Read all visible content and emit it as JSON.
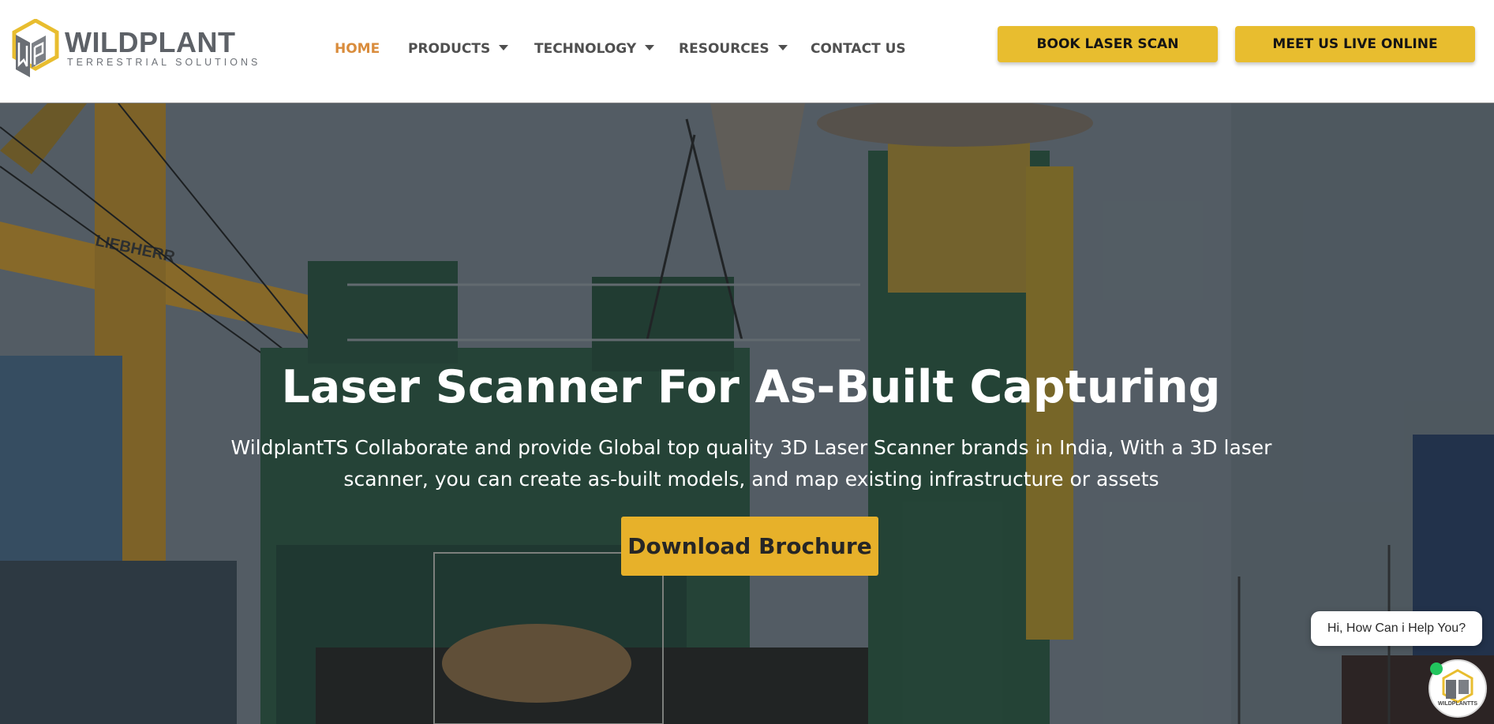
{
  "brand": {
    "name": "WILDPLANT",
    "tagline": "TERRESTRIAL SOLUTIONS",
    "accent": "#e8bd2f",
    "logo_icon": "wp-cube-logo"
  },
  "nav": {
    "items": [
      {
        "label": "HOME",
        "active": true
      },
      {
        "label": "PRODUCTS",
        "dropdown": true
      },
      {
        "label": "TECHNOLOGY",
        "dropdown": true
      },
      {
        "label": "RESOURCES",
        "dropdown": true
      },
      {
        "label": "CONTACT US"
      }
    ],
    "active_color": "#d98c3c",
    "text_color": "#4f4f4f"
  },
  "header_buttons": {
    "book": "BOOK LASER SCAN",
    "meet": "MEET US LIVE ONLINE"
  },
  "hero": {
    "title": "Laser Scanner For As-Built Capturing",
    "subtitle": "WildplantTS Collaborate and provide Global top quality 3D Laser Scanner brands in India, With a 3D laser scanner, you can create as-built models, and map existing infrastructure or assets",
    "cta": "Download Brochure",
    "background_image": "industrial-ship-crane-photo",
    "crane_label": "LIEBHERR"
  },
  "chat": {
    "prompt": "Hi, How Can i Help You?",
    "avatar_label": "WILDPLANTTS",
    "status_color": "#22c55e",
    "icon": "chat-avatar-icon"
  }
}
